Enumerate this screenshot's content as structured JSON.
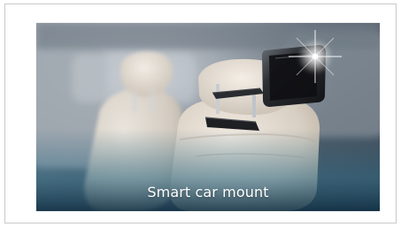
{
  "banner": {
    "caption": "Smart car mount"
  },
  "image": {
    "subject": "car-headrest-tablet-mount",
    "palette": {
      "interior_dark": "#3f4a57",
      "interior_mid": "#7f8b95",
      "seat_light": "#e9e1d6",
      "teal_glow": "#2f6b86",
      "mount_black": "#1f1f22",
      "metal": "#b8bcc1"
    }
  }
}
